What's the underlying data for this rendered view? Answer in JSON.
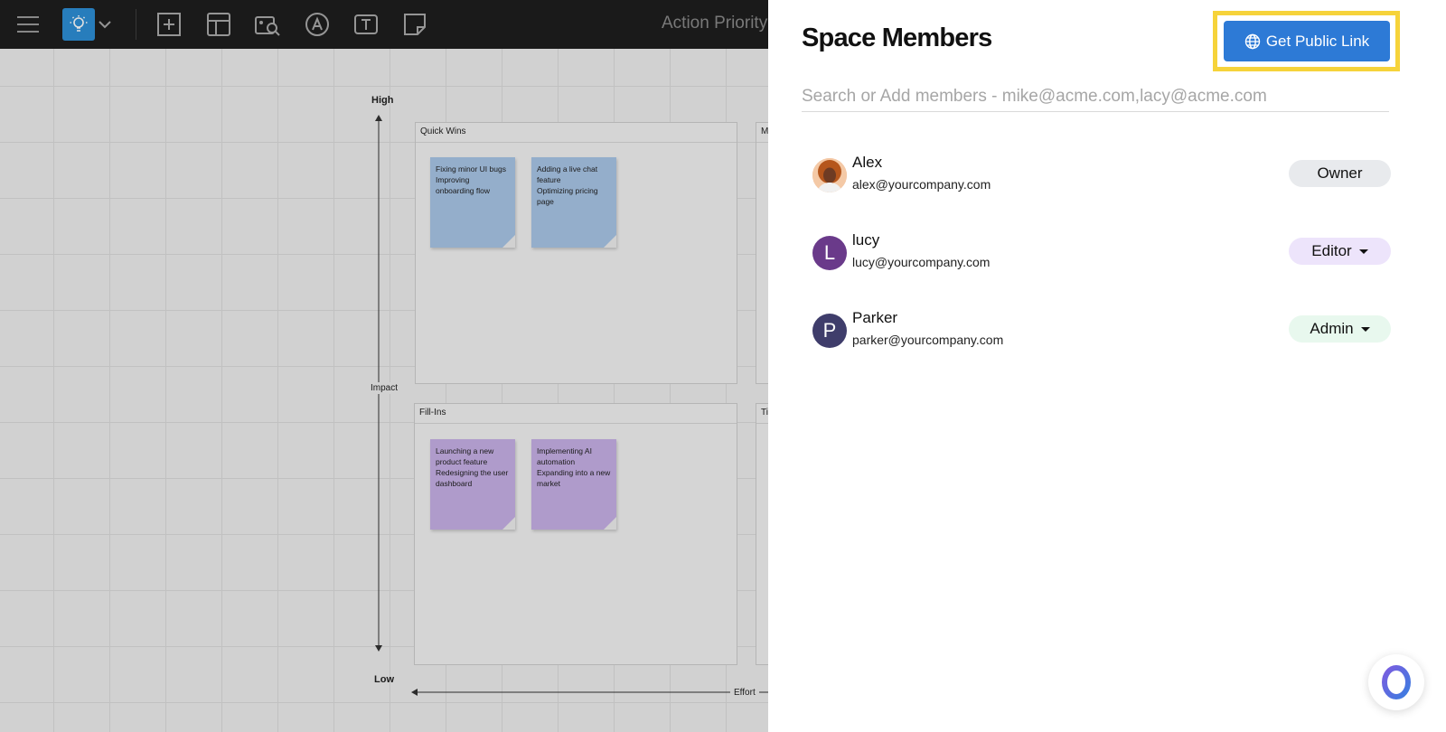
{
  "toolbar": {
    "board_title": "Action Priority",
    "tools": [
      "menu-icon",
      "lightbulb-icon",
      "chevron-down-icon",
      "add-frame-icon",
      "template-icon",
      "image-search-icon",
      "pen-icon",
      "text-icon",
      "sticky-note-icon"
    ],
    "accent": "#2d8fd6"
  },
  "canvas": {
    "axis_high": "High",
    "axis_low": "Low",
    "axis_impact": "Impact",
    "axis_effort": "Effort",
    "frames": [
      {
        "title": "Quick Wins"
      },
      {
        "title": "M"
      },
      {
        "title": "Fill-Ins"
      },
      {
        "title": "Ti"
      }
    ],
    "stickies": [
      {
        "color": "blue",
        "lines": [
          "Fixing minor UI bugs",
          "Improving",
          "onboarding flow"
        ]
      },
      {
        "color": "blue",
        "lines": [
          "Adding a live chat",
          "feature",
          "Optimizing pricing",
          "page"
        ]
      },
      {
        "color": "purple",
        "lines": [
          "Launching a new",
          "product feature",
          "Redesigning the user",
          "dashboard"
        ]
      },
      {
        "color": "purple",
        "lines": [
          "Implementing AI",
          "automation",
          "Expanding into a new",
          "market"
        ]
      }
    ]
  },
  "panel": {
    "title": "Space Members",
    "public_link_label": "Get Public Link",
    "search_placeholder": "Search or Add members - mike@acme.com,lacy@acme.com",
    "members": [
      {
        "name": "Alex",
        "email": "alex@yourcompany.com",
        "role": "Owner",
        "role_bg": "#e8eaed",
        "avatar": "photo",
        "avatar_color": "#c8642a"
      },
      {
        "name": "lucy",
        "email": "lucy@yourcompany.com",
        "role": "Editor",
        "role_bg": "#ede4fb",
        "avatar_initial": "L",
        "avatar_color": "#6a3a8a"
      },
      {
        "name": "Parker",
        "email": "parker@yourcompany.com",
        "role": "Admin",
        "role_bg": "#e8f8ee",
        "avatar_initial": "P",
        "avatar_color": "#3f3d6b"
      }
    ]
  },
  "colors": {
    "highlight": "#f6d33a",
    "primary_button": "#2d7ad6"
  }
}
